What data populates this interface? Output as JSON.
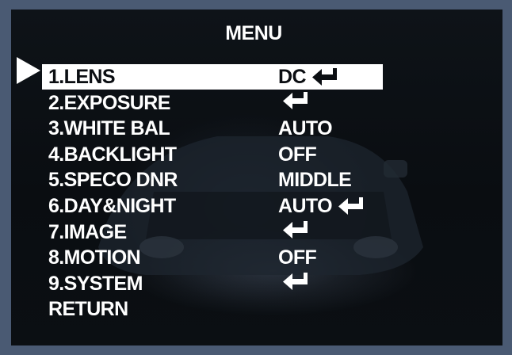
{
  "menu": {
    "title": "MENU",
    "items": [
      {
        "label": "1.LENS",
        "value": "DC",
        "enter": true
      },
      {
        "label": "2.EXPOSURE",
        "value": "",
        "enter": true
      },
      {
        "label": "3.WHITE BAL",
        "value": "AUTO",
        "enter": false
      },
      {
        "label": "4.BACKLIGHT",
        "value": "OFF",
        "enter": false
      },
      {
        "label": "5.SPECO DNR",
        "value": "MIDDLE",
        "enter": false
      },
      {
        "label": "6.DAY&NIGHT",
        "value": "AUTO",
        "enter": true
      },
      {
        "label": "7.IMAGE",
        "value": "",
        "enter": true
      },
      {
        "label": "8.MOTION",
        "value": "OFF",
        "enter": false
      },
      {
        "label": "9.SYSTEM",
        "value": "",
        "enter": true
      },
      {
        "label": "RETURN",
        "value": "",
        "enter": false
      }
    ],
    "selected_index": 0,
    "enter_icon": "return-arrow-icon",
    "cursor_icon": "triangle-right-icon"
  },
  "colors": {
    "background_frame": "#4a5a73",
    "screen": "#0b0e12",
    "text": "#ffffff",
    "highlight": "#ffffff"
  }
}
